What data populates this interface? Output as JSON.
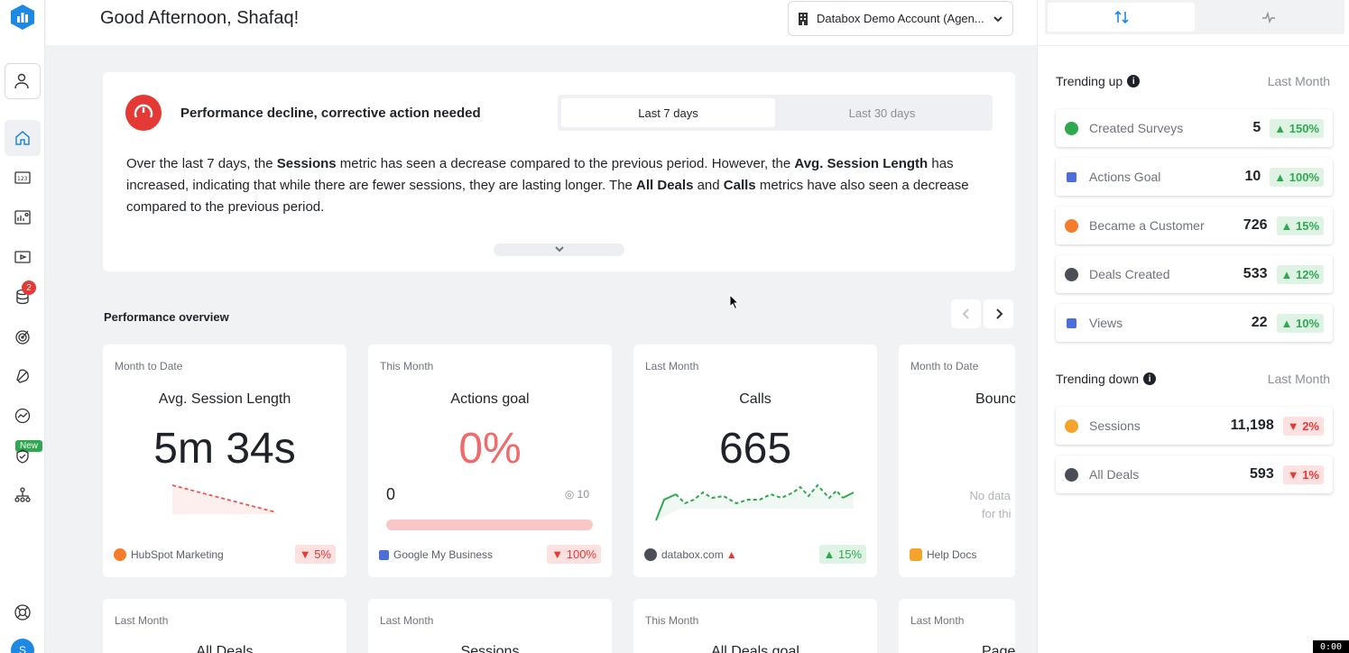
{
  "header": {
    "greeting": "Good Afternoon, Shafaq!",
    "account": "Databox Demo Account (Agen..."
  },
  "sidebar": {
    "alerts_badge": "2",
    "new_label": "New",
    "avatar_initial": "S"
  },
  "insight": {
    "title": "Performance decline, corrective action needed",
    "tabs": [
      "Last 7 days",
      "Last 30 days"
    ],
    "text_parts": [
      "Over the last 7 days, the ",
      "Sessions",
      " metric has seen a decrease compared to the previous period. However, the ",
      "Avg. Session Length",
      " has increased, indicating that while there are fewer sessions, they are lasting longer. The ",
      "All Deals",
      " and ",
      "Calls",
      " metrics have also seen a decrease compared to the previous period."
    ]
  },
  "overview": {
    "title": "Performance overview",
    "cards": [
      {
        "period": "Month to Date",
        "title": "Avg. Session Length",
        "value": "5m 34s",
        "source": "HubSpot Marketing",
        "change": "▼ 5%"
      },
      {
        "period": "This Month",
        "title": "Actions goal",
        "value": "0%",
        "goal_current": "0",
        "goal_target": "10",
        "source": "Google My Business",
        "change": "▼ 100%"
      },
      {
        "period": "Last Month",
        "title": "Calls",
        "value": "665",
        "source": "databox.com",
        "change": "▲ 15%"
      },
      {
        "period": "Month to Date",
        "title": "Bounc",
        "nodata_line1": "No data",
        "nodata_line2": "for thi",
        "source": "Help Docs"
      }
    ],
    "cards_row2": [
      {
        "period": "Last Month",
        "title": "All Deals"
      },
      {
        "period": "Last Month",
        "title": "Sessions"
      },
      {
        "period": "This Month",
        "title": "All Deals goal"
      },
      {
        "period": "Last Month",
        "title": "Page"
      }
    ]
  },
  "trending": {
    "up_title": "Trending up",
    "up_period": "Last Month",
    "up": [
      {
        "name": "Created Surveys",
        "value": "5",
        "change": "▲ 150%",
        "color": "#2fa84f"
      },
      {
        "name": "Actions Goal",
        "value": "10",
        "change": "▲ 100%",
        "color": "#4a6fd8"
      },
      {
        "name": "Became a Customer",
        "value": "726",
        "change": "▲ 15%",
        "color": "#f57c2a"
      },
      {
        "name": "Deals Created",
        "value": "533",
        "change": "▲ 12%",
        "color": "#4a4f57"
      },
      {
        "name": "Views",
        "value": "22",
        "change": "▲ 10%",
        "color": "#4a6fd8"
      }
    ],
    "down_title": "Trending down",
    "down_period": "Last Month",
    "down": [
      {
        "name": "Sessions",
        "value": "11,198",
        "change": "▼ 2%",
        "color": "#f5a32a"
      },
      {
        "name": "All Deals",
        "value": "593",
        "change": "▼ 1%",
        "color": "#4a4f57"
      }
    ]
  },
  "timer": "0:00"
}
